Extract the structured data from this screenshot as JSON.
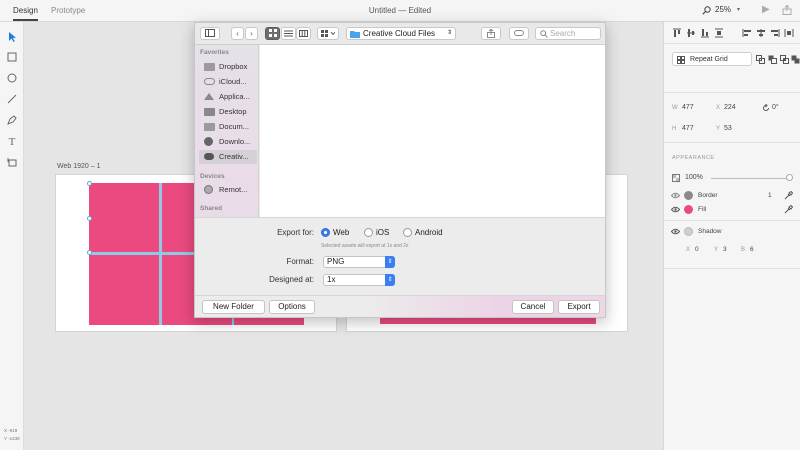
{
  "app": {
    "tabs": [
      "Design",
      "Prototype"
    ],
    "title": "Untitled",
    "title_status": "— Edited",
    "zoom": "25%"
  },
  "canvas": {
    "artboard_label": "Web 1920 – 1",
    "coords_x": "X  -919",
    "coords_y": "Y  -1438"
  },
  "dialog": {
    "location": "Creative Cloud Files",
    "search_placeholder": "Search",
    "sidebar": {
      "favorites_heading": "Favorites",
      "favorites": [
        {
          "label": "Dropbox",
          "icon": "folder-icon"
        },
        {
          "label": "iCloud...",
          "icon": "cloud-icon"
        },
        {
          "label": "Applica...",
          "icon": "applications-icon"
        },
        {
          "label": "Desktop",
          "icon": "desktop-icon"
        },
        {
          "label": "Docum...",
          "icon": "documents-icon"
        },
        {
          "label": "Downlo...",
          "icon": "downloads-icon"
        },
        {
          "label": "Creativ...",
          "icon": "creative-cloud-icon"
        }
      ],
      "devices_heading": "Devices",
      "devices": [
        {
          "label": "Remot...",
          "icon": "disc-icon"
        }
      ],
      "shared_heading": "Shared"
    },
    "export_for_label": "Export for:",
    "export_options": [
      "Web",
      "iOS",
      "Android"
    ],
    "export_selected": "Web",
    "export_hint": "Selected assets will export at 1x and 2x",
    "format_label": "Format:",
    "format_value": "PNG",
    "designed_at_label": "Designed at:",
    "designed_at_value": "1x",
    "buttons": {
      "new_folder": "New Folder",
      "options": "Options",
      "cancel": "Cancel",
      "export": "Export"
    }
  },
  "properties": {
    "repeat_grid": "Repeat Grid",
    "w_label": "W",
    "w": "477",
    "x_label": "X",
    "x": "224",
    "rotation": "0°",
    "h_label": "H",
    "h": "477",
    "y_label": "Y",
    "y": "53",
    "appearance_heading": "APPEARANCE",
    "opacity": "100%",
    "border_label": "Border",
    "border_width": "1",
    "fill_label": "Fill",
    "shadow_label": "Shadow",
    "shadow_x_label": "X",
    "shadow_x": "0",
    "shadow_y_label": "Y",
    "shadow_y": "3",
    "shadow_b_label": "B",
    "shadow_b": "6"
  },
  "colors": {
    "fill": "#ea4a80",
    "accent": "#3a7ef2",
    "border_swatch": "#8a8a8a",
    "shadow_swatch": "#cfcfcf"
  }
}
